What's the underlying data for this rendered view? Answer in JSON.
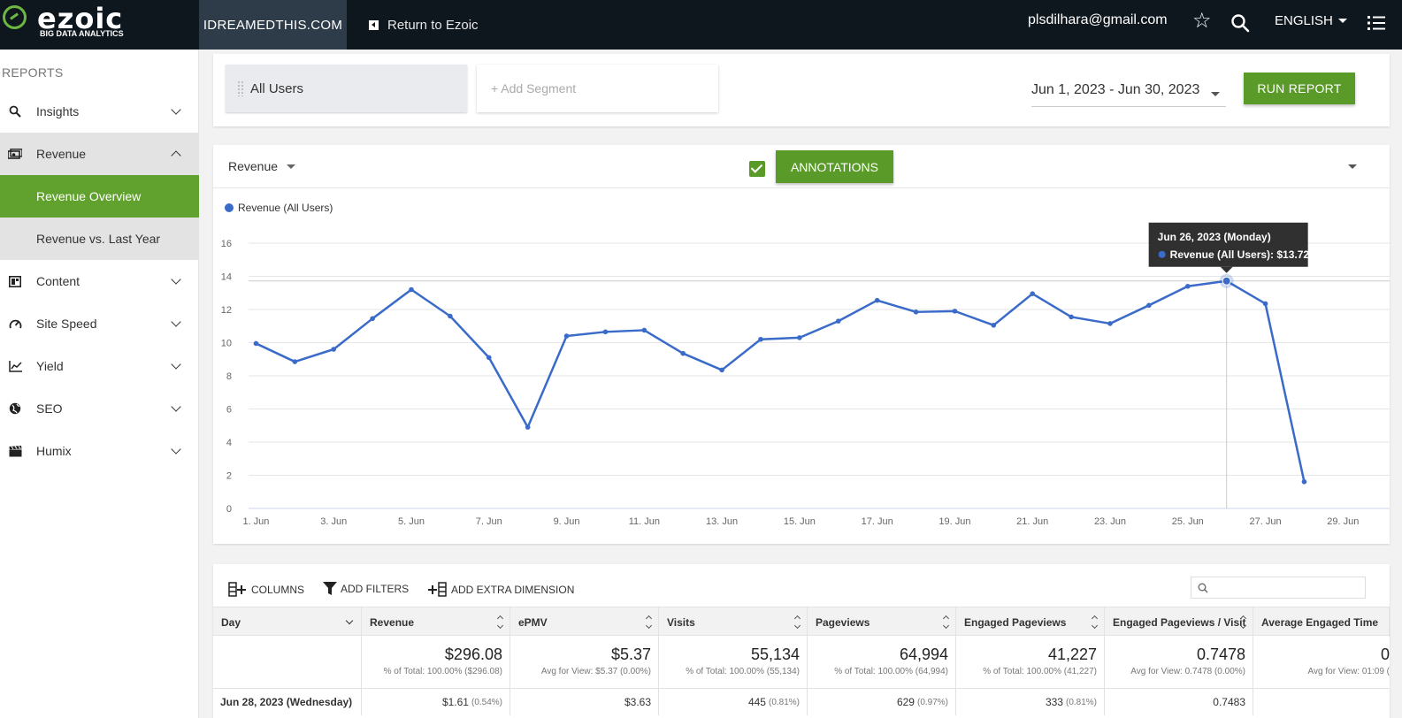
{
  "header": {
    "logo_word": "ezoic",
    "logo_tagline": "BIG DATA ANALYTICS",
    "site_name": "IDREAMEDTHIS.COM",
    "return_label": "Return to Ezoic",
    "email": "plsdilhara@gmail.com",
    "language": "ENGLISH"
  },
  "sidebar": {
    "section_label": "REPORTS",
    "items": [
      {
        "label": "Insights",
        "icon": "search-icon"
      },
      {
        "label": "Revenue",
        "icon": "money-icon"
      },
      {
        "label": "Content",
        "icon": "content-icon"
      },
      {
        "label": "Site Speed",
        "icon": "speedometer-icon"
      },
      {
        "label": "Yield",
        "icon": "chart-line-icon"
      },
      {
        "label": "SEO",
        "icon": "globe-icon"
      },
      {
        "label": "Humix",
        "icon": "clapperboard-icon"
      }
    ],
    "revenue_subitems": [
      "Revenue Overview",
      "Revenue vs. Last Year"
    ]
  },
  "segments": {
    "active": "All Users",
    "add_placeholder": "+ Add Segment"
  },
  "date_range": "Jun 1, 2023 - Jun 30, 2023",
  "run_report_label": "RUN REPORT",
  "chart_panel": {
    "metric": "Revenue",
    "annotations_label": "ANNOTATIONS",
    "annotations_checked": true
  },
  "colors": {
    "accent_green": "#5a9a29",
    "series_blue": "#3a6bc9",
    "topbar": "#0f171e"
  },
  "chart_data": {
    "type": "line",
    "title": "",
    "xlabel": "",
    "ylabel": "",
    "x_days": [
      1,
      2,
      3,
      4,
      5,
      6,
      7,
      8,
      9,
      10,
      11,
      12,
      13,
      14,
      15,
      16,
      17,
      18,
      19,
      20,
      21,
      22,
      23,
      24,
      25,
      26,
      27,
      28
    ],
    "x_ticks": [
      "1. Jun",
      "3. Jun",
      "5. Jun",
      "7. Jun",
      "9. Jun",
      "11. Jun",
      "13. Jun",
      "15. Jun",
      "17. Jun",
      "19. Jun",
      "21. Jun",
      "23. Jun",
      "25. Jun",
      "27. Jun",
      "29. Jun"
    ],
    "x_tick_days": [
      1,
      3,
      5,
      7,
      9,
      11,
      13,
      15,
      17,
      19,
      21,
      23,
      25,
      27,
      29
    ],
    "xlim": [
      0.99,
      30.2
    ],
    "y_ticks": [
      0,
      2,
      4,
      6,
      8,
      10,
      12,
      14,
      16
    ],
    "ylim": [
      0,
      16
    ],
    "grid": true,
    "legend_position": "top-left",
    "series": [
      {
        "name": "Revenue (All Users)",
        "color": "#3a6bc9",
        "values": [
          9.95,
          8.85,
          9.6,
          11.45,
          13.2,
          11.6,
          9.1,
          4.9,
          10.4,
          10.65,
          10.75,
          9.35,
          8.35,
          10.2,
          10.3,
          11.3,
          12.55,
          11.85,
          11.9,
          11.05,
          12.95,
          11.55,
          11.15,
          12.25,
          13.4,
          13.72,
          12.35,
          1.61
        ]
      }
    ],
    "tooltip": {
      "day": 26,
      "title": "Jun 26, 2023 (Monday)",
      "label": "Revenue (All Users): $13.72"
    }
  },
  "table": {
    "tools": [
      "COLUMNS",
      "ADD FILTERS",
      "ADD EXTRA DIMENSION"
    ],
    "columns": [
      "Day",
      "Revenue",
      "ePMV",
      "Visits",
      "Pageviews",
      "Engaged Pageviews",
      "Engaged Pageviews / Visit",
      "Average Engaged Time"
    ],
    "totals": [
      {
        "big": "",
        "small": ""
      },
      {
        "big": "$296.08",
        "small": "% of Total: 100.00% ($296.08)"
      },
      {
        "big": "$5.37",
        "small": "Avg for View: $5.37 (0.00%)"
      },
      {
        "big": "55,134",
        "small": "% of Total: 100.00% (55,134)"
      },
      {
        "big": "64,994",
        "small": "% of Total: 100.00% (64,994)"
      },
      {
        "big": "41,227",
        "small": "% of Total: 100.00% (41,227)"
      },
      {
        "big": "0.7478",
        "small": "Avg for View: 0.7478 (0.00%)"
      },
      {
        "big": "0",
        "small": "Avg for View: 01:09 ("
      }
    ],
    "first_row": [
      {
        "v": "Jun 28, 2023 (Wednesday)",
        "p": ""
      },
      {
        "v": "$1.61",
        "p": "(0.54%)"
      },
      {
        "v": "$3.63",
        "p": ""
      },
      {
        "v": "445",
        "p": "(0.81%)"
      },
      {
        "v": "629",
        "p": "(0.97%)"
      },
      {
        "v": "333",
        "p": "(0.81%)"
      },
      {
        "v": "0.7483",
        "p": ""
      },
      {
        "v": "",
        "p": ""
      }
    ]
  }
}
